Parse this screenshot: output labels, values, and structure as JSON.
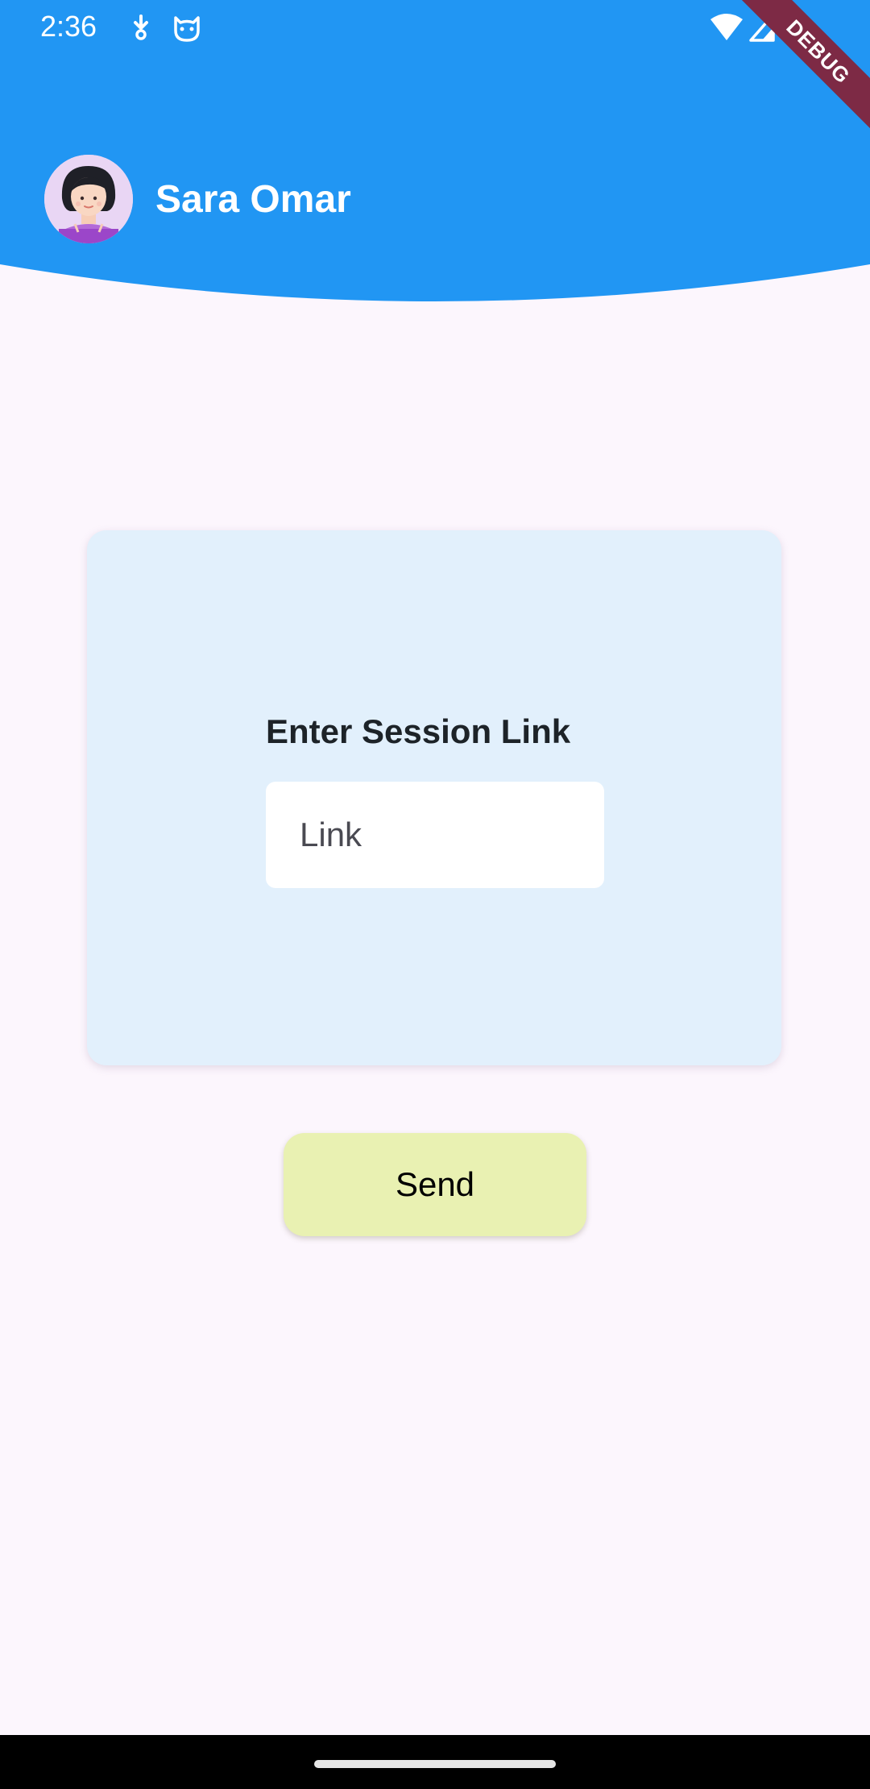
{
  "status_bar": {
    "time": "2:36",
    "icons": [
      "download-icon",
      "cat-face-icon",
      "wifi-icon",
      "signal-icon"
    ]
  },
  "debug_banner": {
    "label": "DEBUG"
  },
  "header": {
    "user_name": "Sara Omar",
    "avatar": "avatar-woman-illustration"
  },
  "session_card": {
    "title": "Enter Session Link",
    "input_value": "",
    "input_placeholder": "Link"
  },
  "actions": {
    "send_label": "Send"
  },
  "colors": {
    "header_blue": "#2196f3",
    "page_background": "#fcf6fd",
    "card_background": "#e2f0fc",
    "send_button": "#e9f1b2",
    "debug_ribbon": "#7d2a45"
  }
}
